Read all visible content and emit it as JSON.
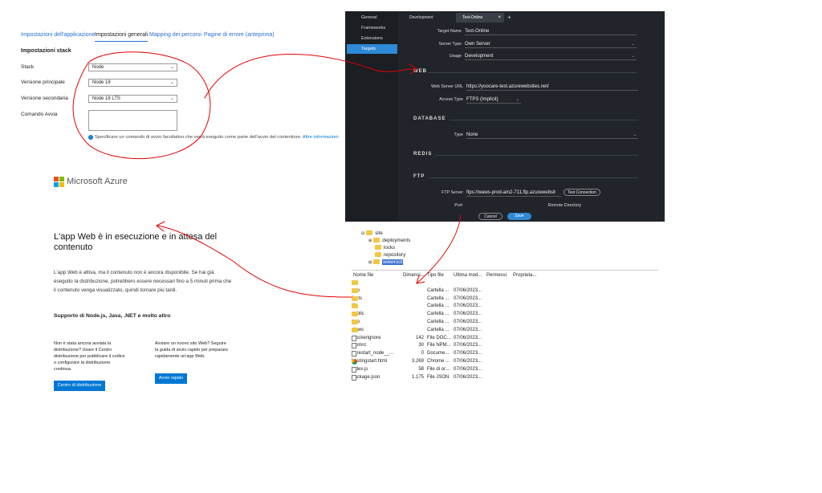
{
  "azure_settings": {
    "tabs": [
      "Impostazioni dell'applicazione",
      "Impostazioni generali",
      "Mapping dei percorsi",
      "Pagine di errore (anteprima)"
    ],
    "section_title": "Impostazioni stack",
    "stack_label": "Stack",
    "stack_value": "Node",
    "major_label": "Versione principale",
    "major_value": "Node 18",
    "minor_label": "Versione secondaria",
    "minor_value": "Node 18 LTS",
    "startup_label": "Comando Avvia",
    "hint": "Specificare un comando di avvio facoltativo che verrà eseguito come parte dell'avvio del contenitore.",
    "hint_link": "Altre informazioni"
  },
  "azure_page": {
    "logo_text": "Microsoft Azure",
    "heading": "L'app Web è in esecuzione e in attesa del contenuto",
    "body": "L'app Web è attiva, ma il contenuto non è ancora disponibile. Se hai già eseguito la distribuzione, potrebbero essere necessari fino a 5 minuti prima che il contenuto venga visualizzato, quindi tornare più tardi.",
    "support_title": "Supporto di Node.js, Java, .NET e molto altro",
    "col1_text": "Non è stata ancora avviata la distribuzione? Usare il Centro distribuzione per pubblicare il codice o configurare la distribuzione continua.",
    "col1_button": "Centro di distribuzione",
    "col2_text": "Avviare un nuovo sito Web? Seguire la guida di avvio rapido per preparare rapidamente un'app Web.",
    "col2_button": "Avvio rapido"
  },
  "ftp_dialog": {
    "sidebar": [
      "General",
      "Frameworks",
      "Extensions",
      "Targets"
    ],
    "tabs": [
      "Development",
      "Test-Online"
    ],
    "add_tab": "+",
    "close_tab": "×",
    "target_name_label": "Target Name",
    "target_name_value": "Test-Online",
    "server_type_label": "Server Type",
    "server_type_value": "Own Server",
    "usage_label": "Usage",
    "usage_value": "Development",
    "web_section": "WEB",
    "web_url_label": "Web Server URL",
    "web_url_value": "https://yoocare-test.azurewebsites.net/",
    "access_label": "Access Type",
    "access_value": "FTPS (Implicit)",
    "database_section": "DATABASE",
    "type_label": "Type",
    "type_value": "None",
    "redis_section": "REDIS",
    "ftp_section": "FTP",
    "ftp_server_label": "FTP Server",
    "ftp_server_value": "ftps://waws-prod-am2-711.ftp.azurewebsit",
    "test_connection": "Test Connection",
    "port_label": "Port",
    "remote_dir_label": "Remote Directory",
    "cancel": "Cancel",
    "save": "Save"
  },
  "file_tree": {
    "root": "site",
    "children": [
      "deployments",
      "locks",
      "repository",
      "wwwroot"
    ]
  },
  "file_list": {
    "columns": [
      "Nome file",
      "Dimensi...",
      "Tipo file",
      "Ultima mod...",
      "Permessi",
      "Proprieta..."
    ],
    "rows": [
      {
        "name": "..",
        "size": "",
        "type": "",
        "date": "",
        "icon": "folder"
      },
      {
        "name": "app",
        "size": "",
        "type": "Cartella ...",
        "date": "07/06/2023...",
        "icon": "folder"
      },
      {
        "name": "fonts",
        "size": "",
        "type": "Cartella ...",
        "date": "07/06/2023...",
        "icon": "folder"
      },
      {
        "name": "lib",
        "size": "",
        "type": "Cartella ...",
        "date": "07/06/2023...",
        "icon": "folder"
      },
      {
        "name": "public",
        "size": "",
        "type": "Cartella ...",
        "date": "07/06/2023...",
        "icon": "folder"
      },
      {
        "name": "tmp",
        "size": "",
        "type": "Cartella ...",
        "date": "07/06/2023...",
        "icon": "folder"
      },
      {
        "name": "views",
        "size": "",
        "type": "Cartella ...",
        "date": "07/06/2023...",
        "icon": "folder"
      },
      {
        "name": ".dockerignore",
        "size": "142",
        "type": "File DOC...",
        "date": "07/06/2023...",
        "icon": "file"
      },
      {
        "name": ".npmrc",
        "size": "30",
        "type": "File NPM...",
        "date": "07/06/2023...",
        "icon": "file"
      },
      {
        "name": "__restart_node__...",
        "size": "0",
        "type": "Docume...",
        "date": "07/06/2023...",
        "icon": "file"
      },
      {
        "name": "hostingstart.html",
        "size": "3.269",
        "type": "Chrome ...",
        "date": "07/06/2023...",
        "icon": "chrome"
      },
      {
        "name": "index.js",
        "size": "58",
        "type": "File di or...",
        "date": "07/06/2023...",
        "icon": "file"
      },
      {
        "name": "package.json",
        "size": "1.175",
        "type": "File JSON",
        "date": "07/06/2023...",
        "icon": "file"
      }
    ]
  },
  "colors": {
    "accent": "#2e89d6",
    "azure_blue": "#0078d4",
    "annotation_red": "#e00000",
    "dark_bg": "#21252b"
  }
}
